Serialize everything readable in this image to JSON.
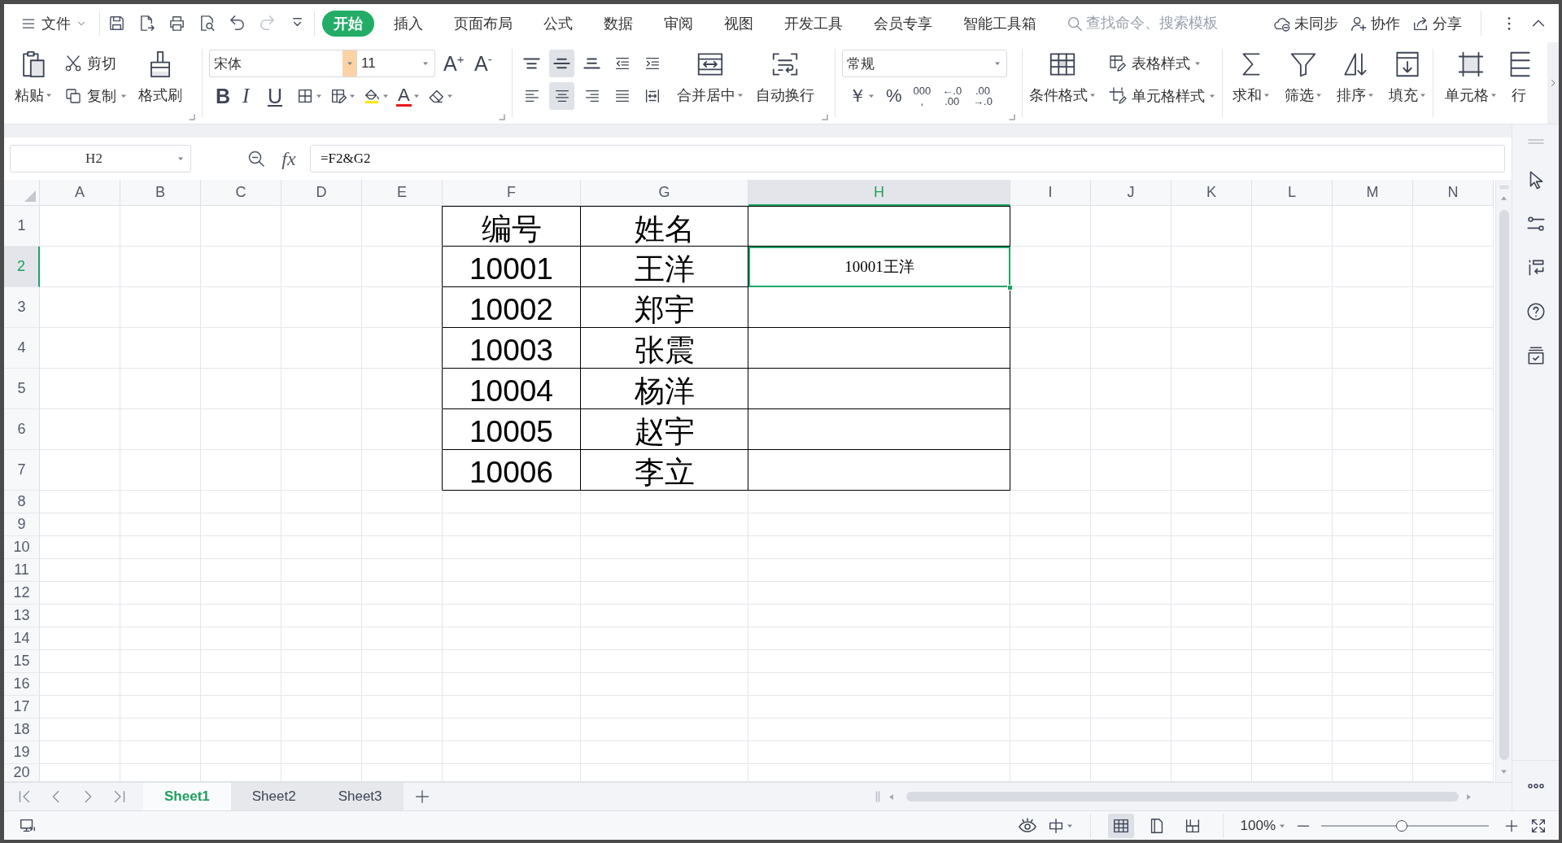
{
  "menu_bar": {
    "file_menu": {
      "label": "文件"
    },
    "quick_access": [
      {
        "kind": "save",
        "disabled": false
      },
      {
        "kind": "export",
        "disabled": false
      },
      {
        "kind": "print",
        "disabled": false
      },
      {
        "kind": "preview",
        "disabled": false
      },
      {
        "kind": "undo",
        "disabled": false
      },
      {
        "kind": "redo",
        "disabled": true
      },
      {
        "kind": "customize",
        "disabled": false
      }
    ],
    "tabs": [
      {
        "label": "开始",
        "selected": true
      },
      {
        "label": "插入",
        "selected": false
      },
      {
        "label": "页面布局",
        "selected": false
      },
      {
        "label": "公式",
        "selected": false
      },
      {
        "label": "数据",
        "selected": false
      },
      {
        "label": "审阅",
        "selected": false
      },
      {
        "label": "视图",
        "selected": false
      },
      {
        "label": "开发工具",
        "selected": false
      },
      {
        "label": "会员专享",
        "selected": false
      },
      {
        "label": "智能工具箱",
        "selected": false
      }
    ],
    "search": {
      "placeholder": "查找命令、搜索模板"
    },
    "actions": [
      {
        "kind": "sync",
        "label": "未同步"
      },
      {
        "kind": "collaborate",
        "label": "协作"
      },
      {
        "kind": "share",
        "label": "分享"
      }
    ]
  },
  "ribbon": {
    "clipboard": {
      "paste": "粘贴",
      "cut": "剪切",
      "copy": "复制",
      "format_painter": "格式刷"
    },
    "font": {
      "name": "宋体",
      "size": "11",
      "grow": "A$^{+}$",
      "shrink": "A$^{-}$",
      "bold": "B",
      "italic": "I",
      "underline": "U",
      "font_color": "A"
    },
    "alignment": {
      "vertical": [
        {
          "kind": "top",
          "selected": false
        },
        {
          "kind": "middle",
          "selected": true
        },
        {
          "kind": "bottom",
          "selected": false
        }
      ],
      "horizontal": [
        {
          "kind": "left",
          "selected": false
        },
        {
          "kind": "center",
          "selected": true
        },
        {
          "kind": "right",
          "selected": false
        },
        {
          "kind": "justify",
          "selected": false
        },
        {
          "kind": "distributed",
          "selected": false
        }
      ],
      "merge_center": "合并居中",
      "wrap_text": "自动换行"
    },
    "number": {
      "format": "常规",
      "currency": "￥",
      "percent": "%",
      "thousands": [
        "000",
        ","
      ],
      "increase_decimal": [
        "←.0",
        ".00"
      ],
      "decrease_decimal": [
        ".00",
        "→.0"
      ]
    },
    "styles": {
      "conditional_format": "条件格式",
      "table_style": "表格样式",
      "cell_style": "单元格样式"
    },
    "editing": [
      {
        "kind": "sum",
        "label": "求和"
      },
      {
        "kind": "filter",
        "label": "筛选"
      },
      {
        "kind": "sort",
        "label": "排序"
      },
      {
        "kind": "fill",
        "label": "填充"
      }
    ],
    "cells": [
      {
        "kind": "cell",
        "label": "单元格"
      },
      {
        "kind": "row-column",
        "label": "行"
      }
    ]
  },
  "formula_bar": {
    "name_box": "H2",
    "fx": "fx",
    "formula": "=F2&G2"
  },
  "sheet": {
    "columns": [
      {
        "label": "A",
        "selected": false
      },
      {
        "label": "B",
        "selected": false
      },
      {
        "label": "C",
        "selected": false
      },
      {
        "label": "D",
        "selected": false
      },
      {
        "label": "E",
        "selected": false
      },
      {
        "label": "F",
        "selected": false
      },
      {
        "label": "G",
        "selected": false
      },
      {
        "label": "H",
        "selected": true
      },
      {
        "label": "I",
        "selected": false
      },
      {
        "label": "J",
        "selected": false
      },
      {
        "label": "K",
        "selected": false
      },
      {
        "label": "L",
        "selected": false
      },
      {
        "label": "M",
        "selected": false
      },
      {
        "label": "N",
        "selected": false
      }
    ],
    "rows": [
      {
        "label": "1",
        "selected": false,
        "cells": [
          {
            "kind": "value",
            "text": "编号",
            "selected": false
          },
          {
            "kind": "value",
            "text": "姓名",
            "selected": false
          },
          {
            "selected": false
          }
        ]
      },
      {
        "label": "2",
        "selected": true,
        "cells": [
          {
            "kind": "value",
            "text": "10001",
            "selected": false
          },
          {
            "kind": "value",
            "text": "王洋",
            "selected": false
          },
          {
            "kind": "formula",
            "text": "10001王洋",
            "selected": true
          }
        ]
      },
      {
        "label": "3",
        "selected": false,
        "cells": [
          {
            "kind": "value",
            "text": "10002",
            "selected": false
          },
          {
            "kind": "value",
            "text": "郑宇",
            "selected": false
          },
          {
            "selected": false
          }
        ]
      },
      {
        "label": "4",
        "selected": false,
        "cells": [
          {
            "kind": "value",
            "text": "10003",
            "selected": false
          },
          {
            "kind": "value",
            "text": "张震",
            "selected": false
          },
          {
            "selected": false
          }
        ]
      },
      {
        "label": "5",
        "selected": false,
        "cells": [
          {
            "kind": "value",
            "text": "10004",
            "selected": false
          },
          {
            "kind": "value",
            "text": "杨洋",
            "selected": false
          },
          {
            "selected": false
          }
        ]
      },
      {
        "label": "6",
        "selected": false,
        "cells": [
          {
            "kind": "value",
            "text": "10005",
            "selected": false
          },
          {
            "kind": "value",
            "text": "赵宇",
            "selected": false
          },
          {
            "selected": false
          }
        ]
      },
      {
        "label": "7",
        "selected": false,
        "cells": [
          {
            "kind": "value",
            "text": "10006",
            "selected": false
          },
          {
            "kind": "value",
            "text": "李立",
            "selected": false
          },
          {
            "selected": false
          }
        ]
      },
      {
        "label": "8",
        "selected": false
      },
      {
        "label": "9",
        "selected": false
      },
      {
        "label": "10",
        "selected": false
      },
      {
        "label": "11",
        "selected": false
      },
      {
        "label": "12",
        "selected": false
      },
      {
        "label": "13",
        "selected": false
      },
      {
        "label": "14",
        "selected": false
      },
      {
        "label": "15",
        "selected": false
      },
      {
        "label": "16",
        "selected": false
      },
      {
        "label": "17",
        "selected": false
      },
      {
        "label": "18",
        "selected": false
      },
      {
        "label": "19",
        "selected": false
      },
      {
        "label": "20",
        "selected": false
      }
    ]
  },
  "sheet_tabs": [
    {
      "label": "Sheet1",
      "selected": true
    },
    {
      "label": "Sheet2",
      "selected": false
    },
    {
      "label": "Sheet3",
      "selected": false
    }
  ],
  "status_bar": {
    "views": [
      {
        "kind": "normal",
        "selected": true
      },
      {
        "kind": "page-layout",
        "selected": false
      },
      {
        "kind": "page-break",
        "selected": false
      }
    ],
    "zoom": "100%",
    "zoom_slider": {
      "level": 0.48
    }
  }
}
